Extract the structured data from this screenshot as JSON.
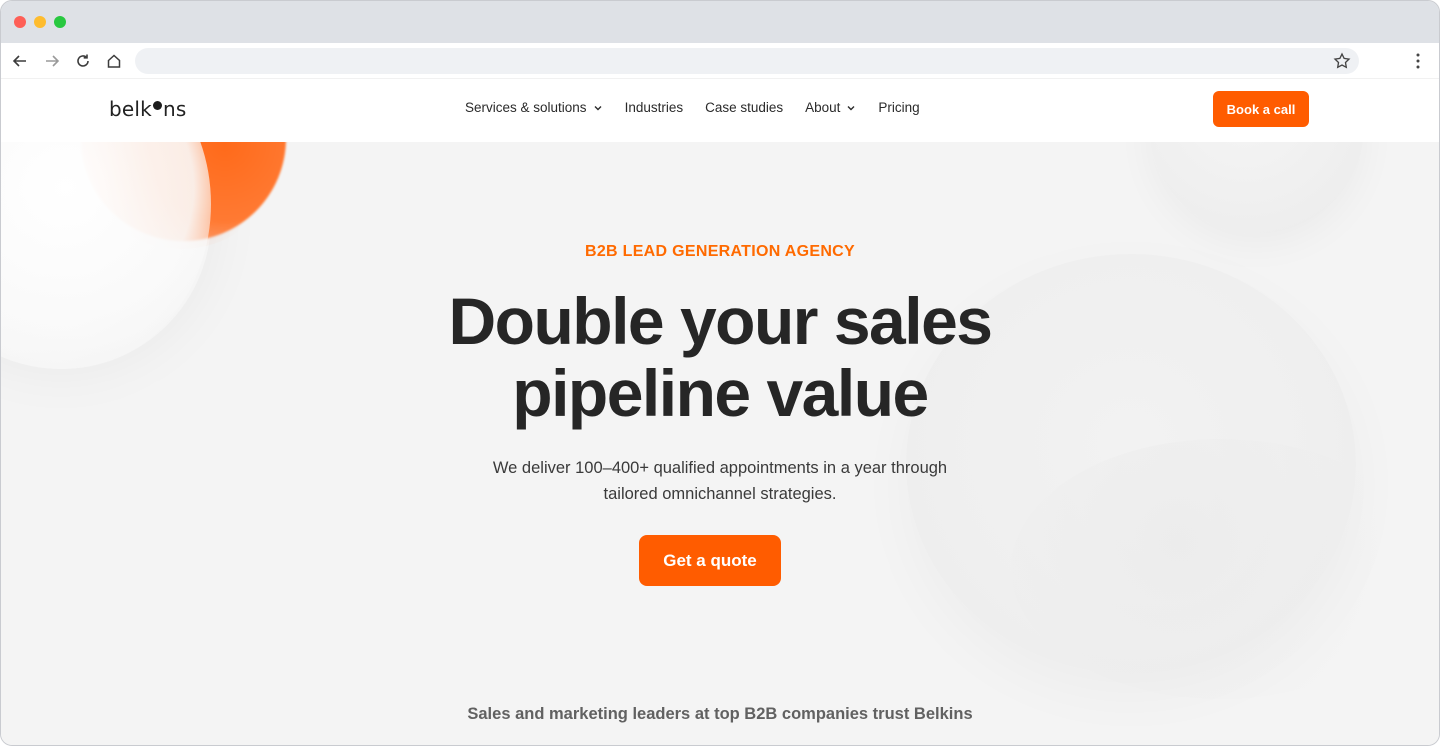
{
  "browser": {
    "back_icon": "arrow-left-icon",
    "forward_icon": "arrow-right-icon",
    "reload_icon": "reload-icon",
    "home_icon": "home-icon",
    "address": "",
    "bookmark_icon": "star-icon",
    "menu_icon": "kebab-menu-icon"
  },
  "header": {
    "logo_text_before": "belk",
    "logo_text_after": "ns",
    "nav": [
      {
        "label": "Services & solutions",
        "has_dropdown": true
      },
      {
        "label": "Industries",
        "has_dropdown": false
      },
      {
        "label": "Case studies",
        "has_dropdown": false
      },
      {
        "label": "About",
        "has_dropdown": true
      },
      {
        "label": "Pricing",
        "has_dropdown": false
      }
    ],
    "cta": "Book a call"
  },
  "hero": {
    "eyebrow": "B2B LEAD GENERATION AGENCY",
    "headline_line1": "Double your sales",
    "headline_line2": "pipeline value",
    "sub_line1": "We deliver 100–400+ qualified appointments in a year through",
    "sub_line2": "tailored omnichannel strategies.",
    "cta": "Get a quote"
  },
  "trust": {
    "text": "Sales and marketing leaders at top B2B companies trust Belkins"
  },
  "colors": {
    "accent": "#ff5c00",
    "eyebrow": "#ff6a00",
    "headline": "#262626",
    "background": "#f4f4f4"
  }
}
